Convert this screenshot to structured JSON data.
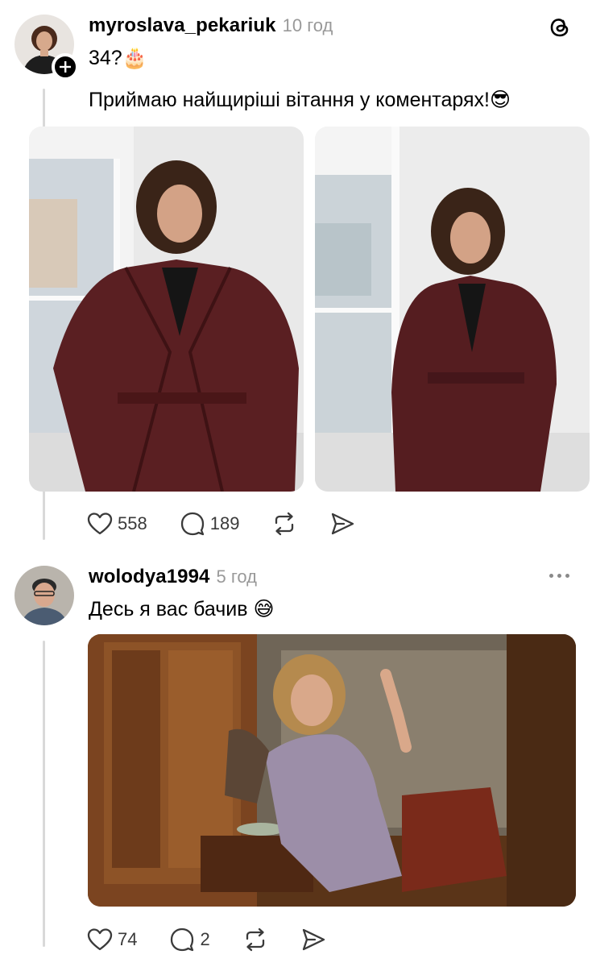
{
  "post": {
    "author": "myroslava_pekariuk",
    "time": "10 год",
    "text_line1": "34?🎂",
    "text_line2": "Приймаю найщиріші вітання у коментарях!😎",
    "likes": "558",
    "replies": "189"
  },
  "reply": {
    "author": "wolodya1994",
    "time": "5 год",
    "text": "Десь я вас бачив 😅",
    "likes": "74",
    "replies": "2"
  },
  "icons": {
    "app": "threads-icon",
    "like": "heart-icon",
    "reply": "comment-icon",
    "repost": "repost-icon",
    "share": "send-icon",
    "more": "more-dots-icon"
  },
  "colors": {
    "text": "#000000",
    "muted": "#999999",
    "icon": "#3a3a3a",
    "thread_line": "#d9d9d9"
  }
}
